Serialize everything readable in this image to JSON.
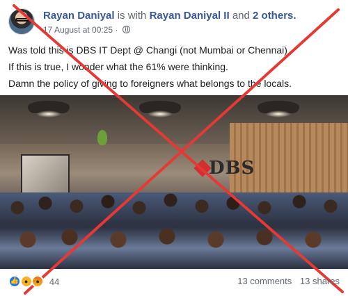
{
  "post": {
    "author": "Rayan Daniyal",
    "with_text": "is with",
    "tagged": "Rayan Daniyal II",
    "and_text": "and",
    "others": "2 others.",
    "timestamp": "17 August at 00:25",
    "privacy_icon": "globe-icon",
    "lines": [
      "Was told this is DBS IT Dept @ Changi (not Mumbai or Chennai)",
      "If this is true, I wonder what the 61% were thinking.",
      "Damn the policy of giving to foreigners what belongs to the locals."
    ]
  },
  "photo": {
    "wall_logo_text": "DBS",
    "overlay_color": "#e53935"
  },
  "footer": {
    "reaction_icons": [
      "like-icon",
      "wow-icon",
      "angry-icon"
    ],
    "reaction_count": "44",
    "comments": "13 comments",
    "shares": "13 shares"
  },
  "colors": {
    "link": "#385898",
    "meta": "#606770",
    "like": "#1877f2",
    "wow": "#f7b125",
    "cross": "#e53935"
  }
}
